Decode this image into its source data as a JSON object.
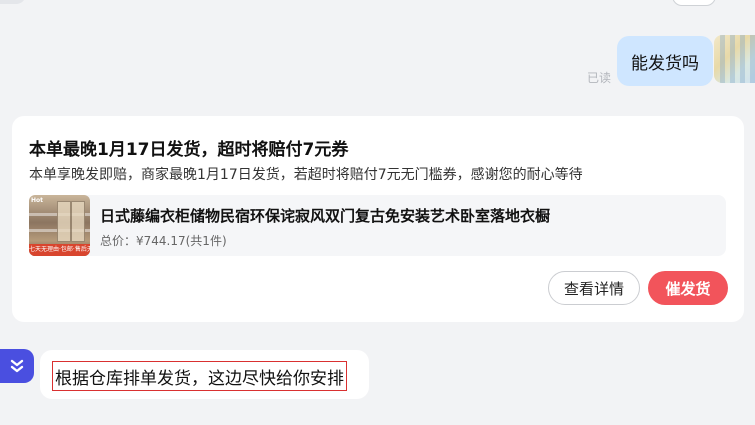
{
  "chat": {
    "user_message": "能发货吗",
    "read_status": "已读"
  },
  "order_card": {
    "title": "本单最晚1月17日发货，超时将赔付7元券",
    "description": "本单享晚发即赔，商家最晚1月17日发货，若超时将赔付7元无门槛券，感谢您的耐心等待",
    "product": {
      "name": "日式藤编衣柜储物民宿环保诧寂风双门复古免安装艺术卧室落地衣橱",
      "price": "总价：¥744.17(共1件)",
      "image_badge": "七天无理由·包邮·售后无忧",
      "image_tag": "Hot"
    },
    "buttons": {
      "detail_label": "查看详情",
      "urge_label": "催发货"
    },
    "colors": {
      "urge_button": "#f2545b",
      "card_background": "#ffffff"
    }
  },
  "agent": {
    "reply": "根据仓库排单发货，这边尽快给你安排",
    "avatar_icon": "double-chevron-down-icon",
    "highlight_color": "#d93030"
  },
  "theme": {
    "page_background": "#f2f3f5",
    "user_bubble": "#cfe6ff",
    "agent_avatar": "#4a4fe0"
  }
}
